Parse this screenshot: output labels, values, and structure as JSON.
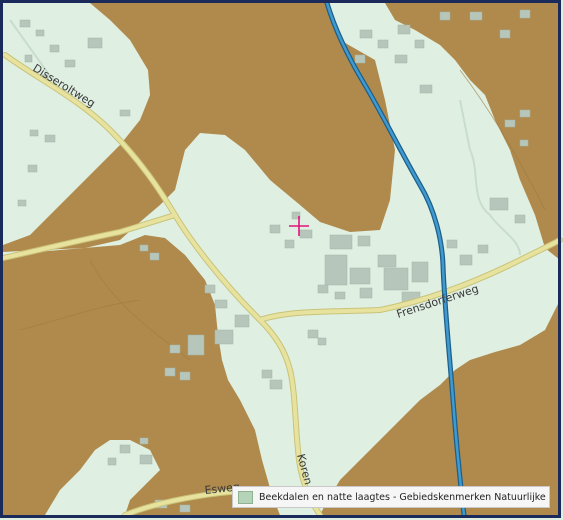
{
  "map": {
    "road_labels": {
      "disseroltweg": "Disseroltweg",
      "frensdorferweg": "Frensdorferweg",
      "esweg": "Esweg",
      "korenweg": "Koren"
    },
    "legend": {
      "label": "Beekdalen en natte laagtes - Gebiedskenmerken Natuurlijke laag",
      "swatch_color": "#b5d3b8"
    },
    "colors": {
      "background": "#dff0e3",
      "natural_layer_overlay": "#b08a4c",
      "stream": "#2f7fb3",
      "road": "#e7e29e",
      "buildings": "#b7c6bb",
      "frame": "#1a2a5a",
      "marker": "#e0147a"
    },
    "marker_icon": "crosshair"
  }
}
